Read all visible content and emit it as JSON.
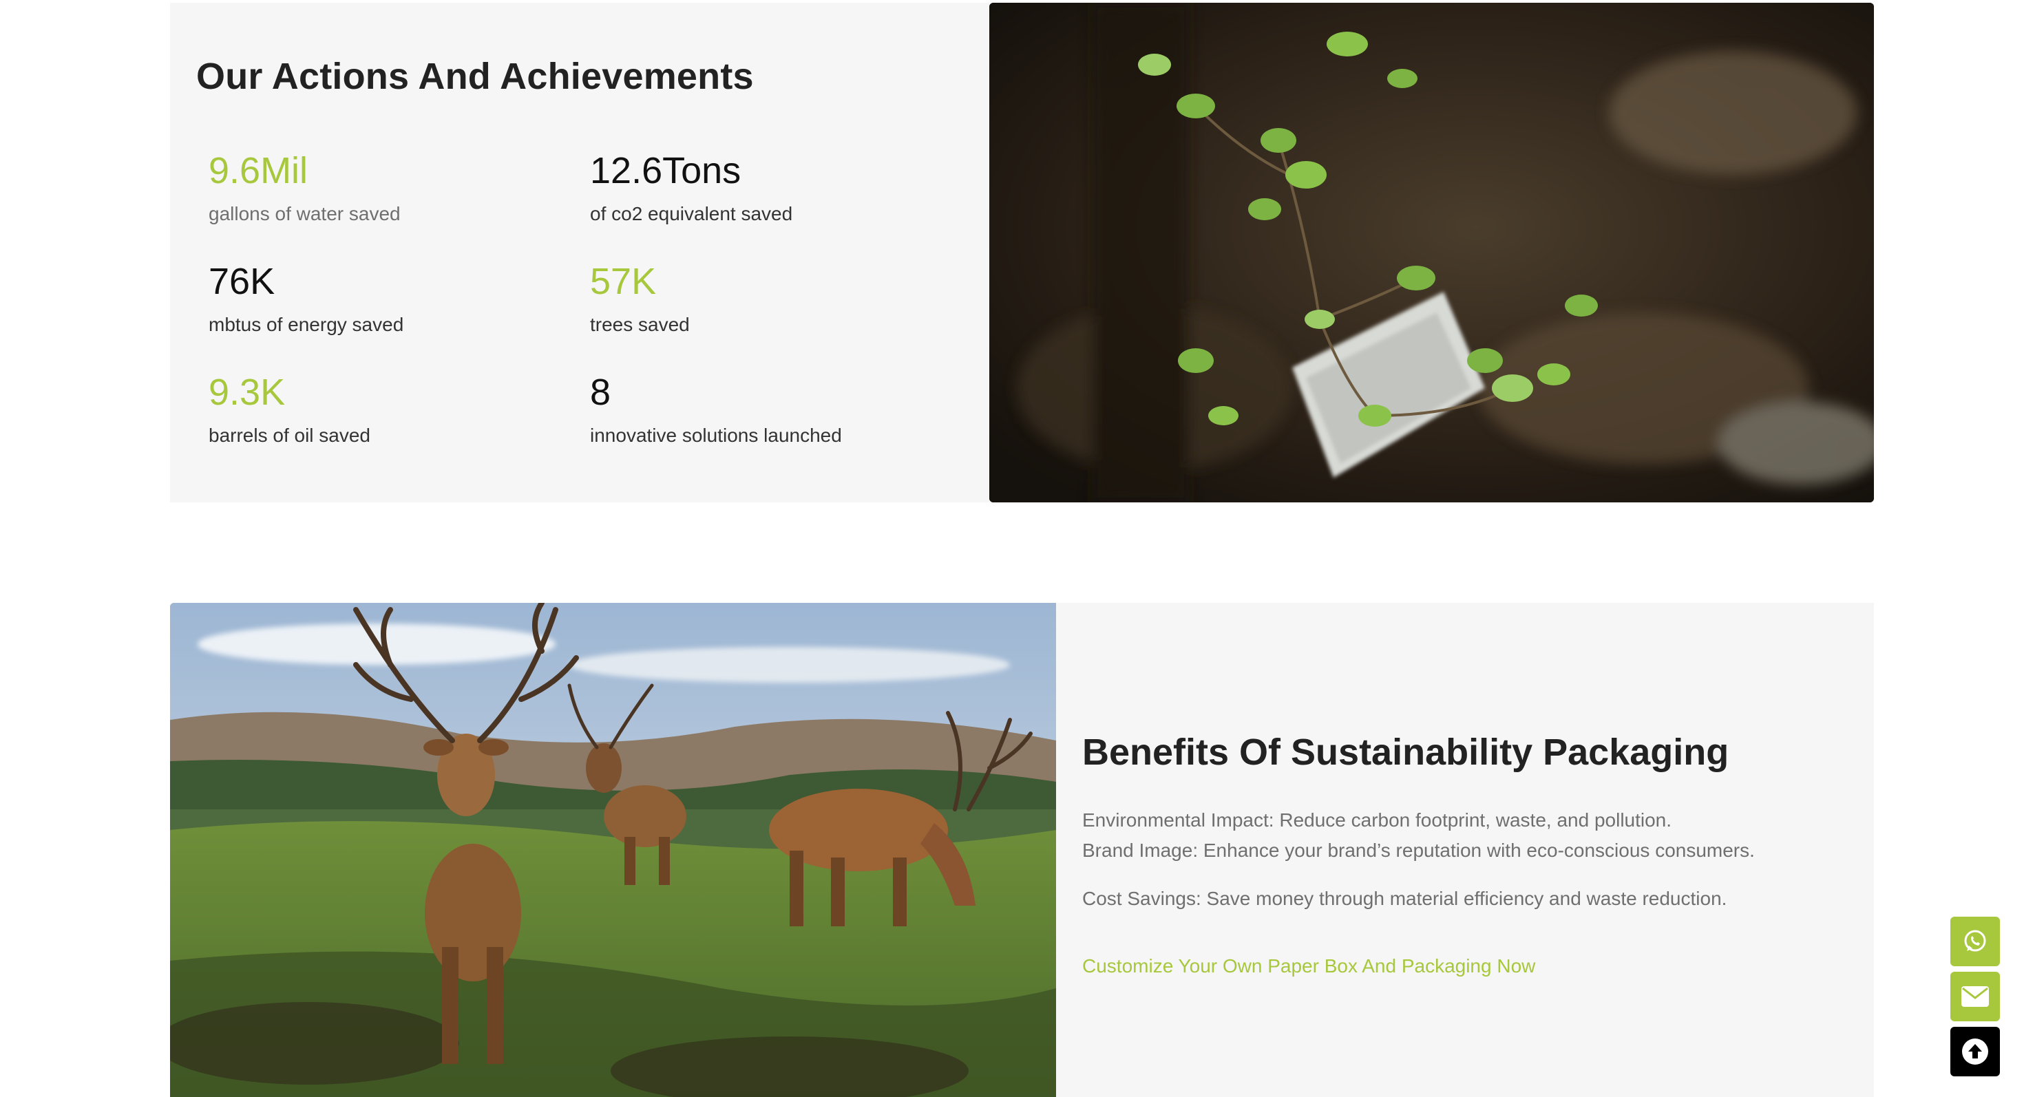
{
  "achievements": {
    "title": "Our Actions And Achievements",
    "stats": [
      {
        "value": "9.6Mil",
        "label": "gallons of water saved"
      },
      {
        "value": "12.6Tons",
        "label": "of co2 equivalent saved"
      },
      {
        "value": "76K",
        "label": "mbtus of energy saved"
      },
      {
        "value": "57K",
        "label": "trees saved"
      },
      {
        "value": "9.3K",
        "label": "barrels of oil saved"
      },
      {
        "value": "8",
        "label": "innovative solutions launched"
      }
    ]
  },
  "benefits": {
    "title": "Benefits Of Sustainability Packaging",
    "lines": [
      "Environmental Impact: Reduce carbon footprint, waste, and pollution.",
      "Brand Image: Enhance your brand’s reputation with eco-conscious consumers.",
      "Cost Savings: Save money through material efficiency and waste reduction."
    ],
    "cta": "Customize Your Own Paper Box And Packaging Now"
  },
  "floating_buttons": [
    {
      "icon": "whatsapp-icon"
    },
    {
      "icon": "mail-icon"
    },
    {
      "icon": "arrow-up-circle-icon"
    }
  ],
  "colors": {
    "accent": "#a7c73d",
    "panel": "#f6f6f6",
    "heading": "#222222",
    "muted": "#6f6f6f"
  }
}
